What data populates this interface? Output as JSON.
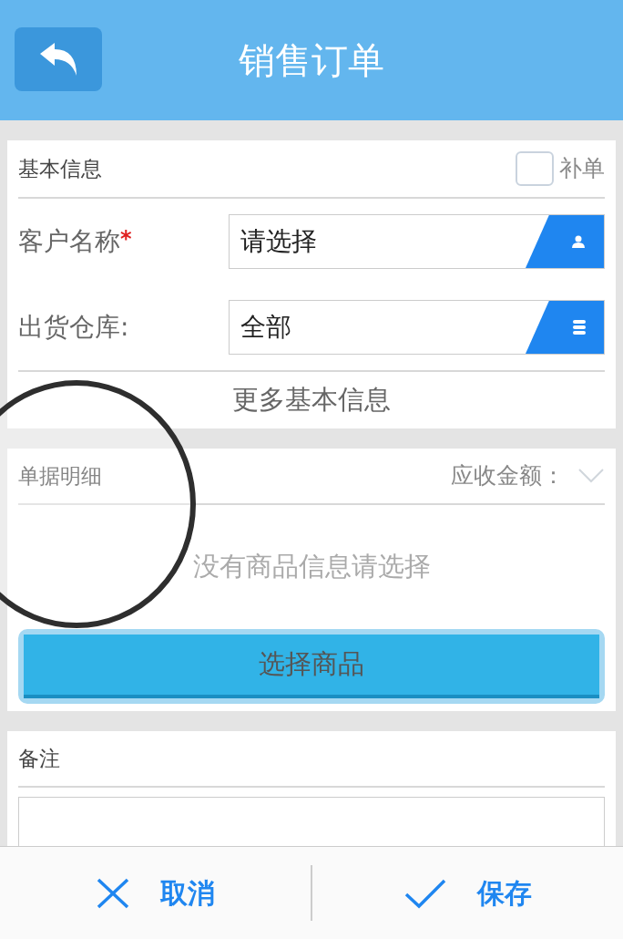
{
  "header": {
    "title": "销售订单"
  },
  "basic_info": {
    "title": "基本信息",
    "supplement": {
      "label": "补单",
      "checked": false
    },
    "fields": [
      {
        "label": "客户名称",
        "required_mark": "*",
        "value": "请选择",
        "kind": "person"
      },
      {
        "label": "出货仓库:",
        "value": "全部",
        "kind": "database"
      }
    ],
    "more_link": "更多基本信息"
  },
  "details": {
    "title": "单据明细",
    "amount_label": "应收金额：",
    "expanded": false,
    "empty_text": "没有商品信息请选择",
    "select_button": "选择商品"
  },
  "remarks": {
    "title": "备注"
  },
  "footer": {
    "buttons": [
      {
        "label": "取消",
        "kind": "cancel"
      },
      {
        "label": "保存",
        "kind": "save"
      }
    ]
  }
}
